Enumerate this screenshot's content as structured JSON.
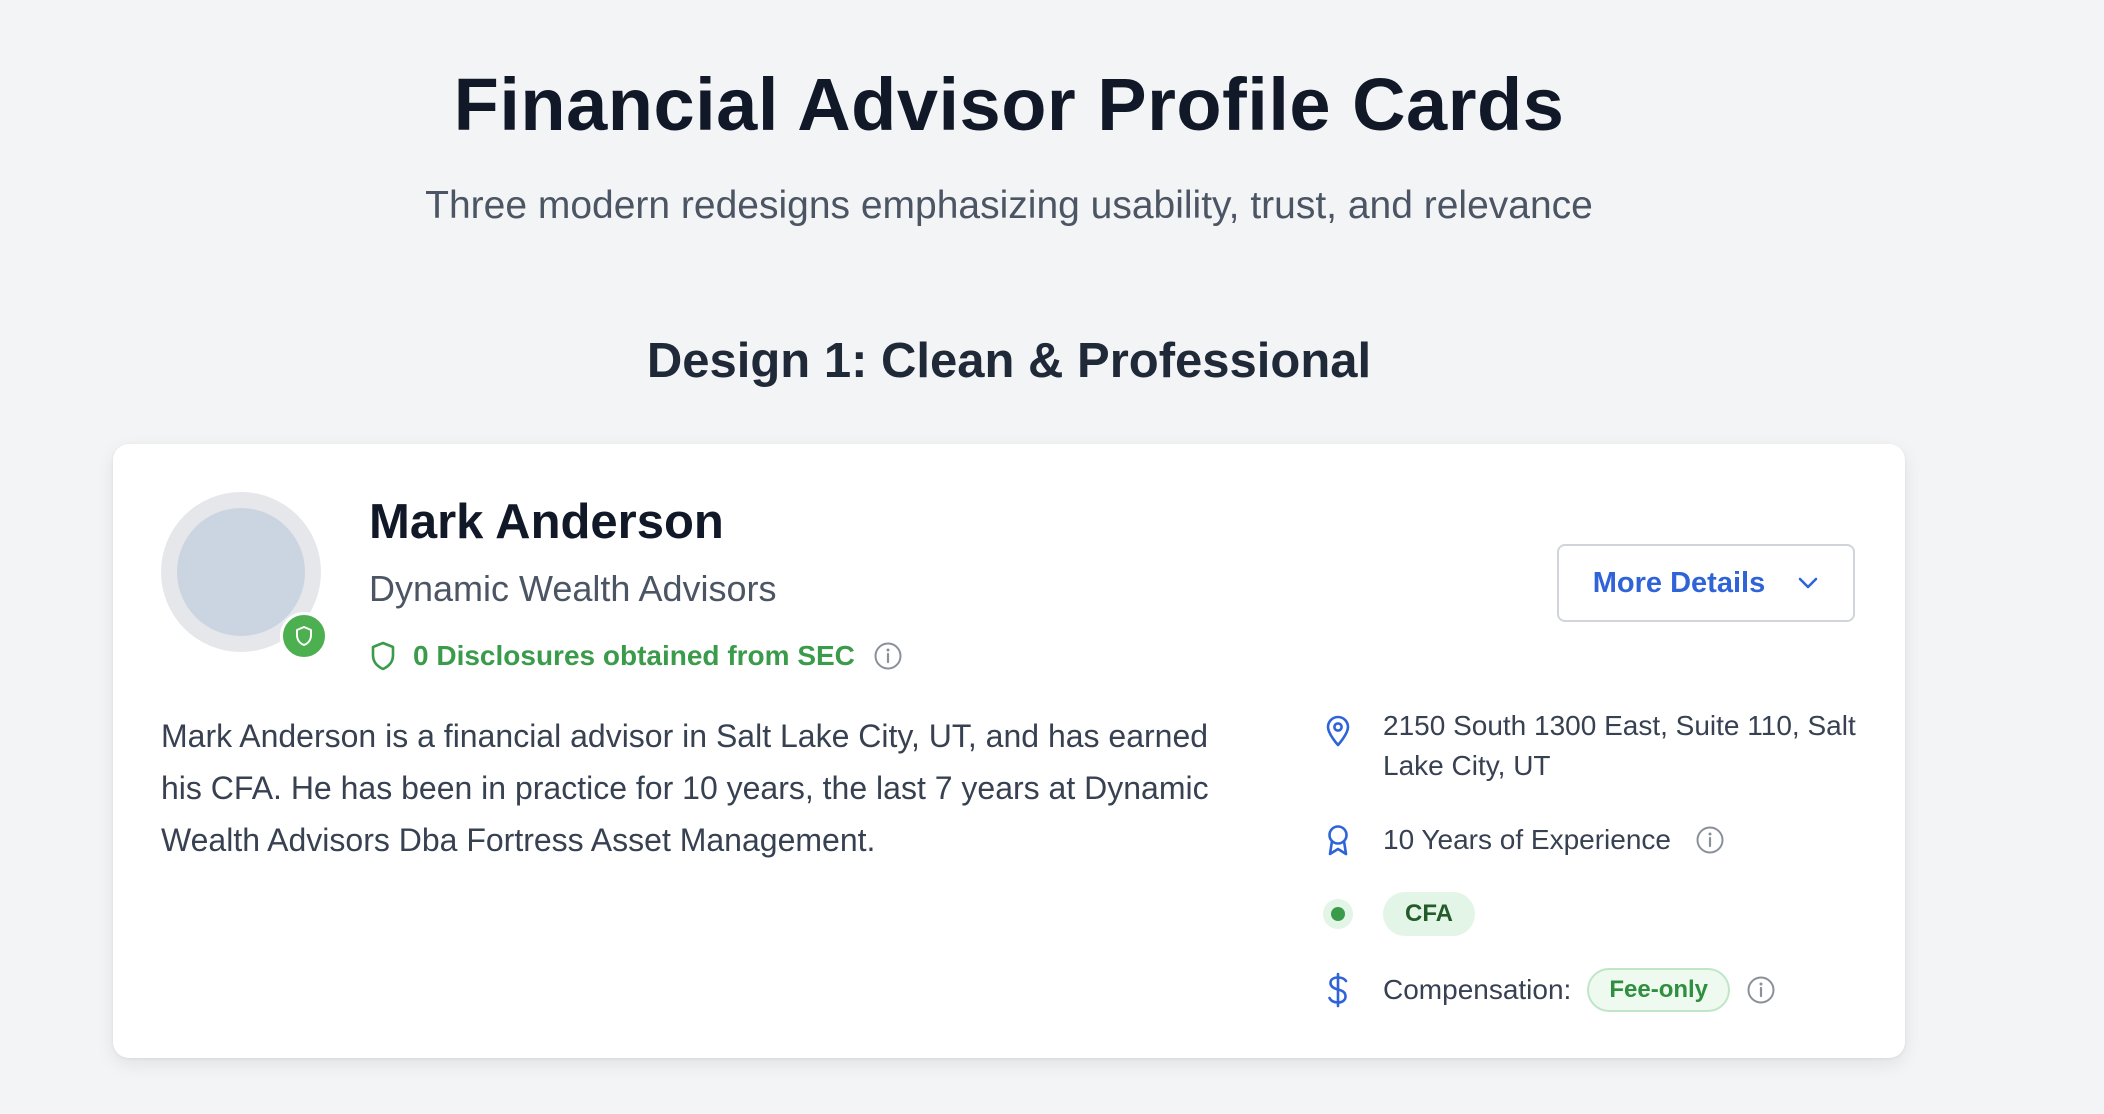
{
  "page": {
    "title": "Financial Advisor Profile Cards",
    "subtitle": "Three modern redesigns emphasizing usability, trust, and relevance",
    "section_title": "Design 1: Clean & Professional"
  },
  "card": {
    "name": "Mark Anderson",
    "firm": "Dynamic Wealth Advisors",
    "disclosures": "0 Disclosures obtained from SEC",
    "more_details_label": "More Details",
    "bio": "Mark Anderson is a financial advisor in Salt Lake City, UT, and has earned his CFA. He has been in practice for 10 years, the last 7 years at Dynamic Wealth Advisors Dba Fortress Asset Management.",
    "address": "2150 South 1300 East, Suite 110, Salt Lake City, UT",
    "experience": "10 Years of Experience",
    "certification": "CFA",
    "compensation_label": "Compensation:",
    "compensation_value": "Fee-only"
  },
  "colors": {
    "background": "#f3f4f6",
    "card": "#ffffff",
    "accent_blue": "#2f63d8",
    "success_green": "#3a9b4a",
    "badge_green_bg": "#e3f5e6",
    "text_primary": "#111827",
    "text_secondary": "#4b5563"
  },
  "icons": {
    "avatar_badge": "shield-icon",
    "disclosures": "shield-icon",
    "info": "info-icon",
    "dropdown": "chevron-down-icon",
    "address": "map-pin-icon",
    "experience": "award-ribbon-icon",
    "certification": "status-dot-icon",
    "compensation": "dollar-icon"
  }
}
